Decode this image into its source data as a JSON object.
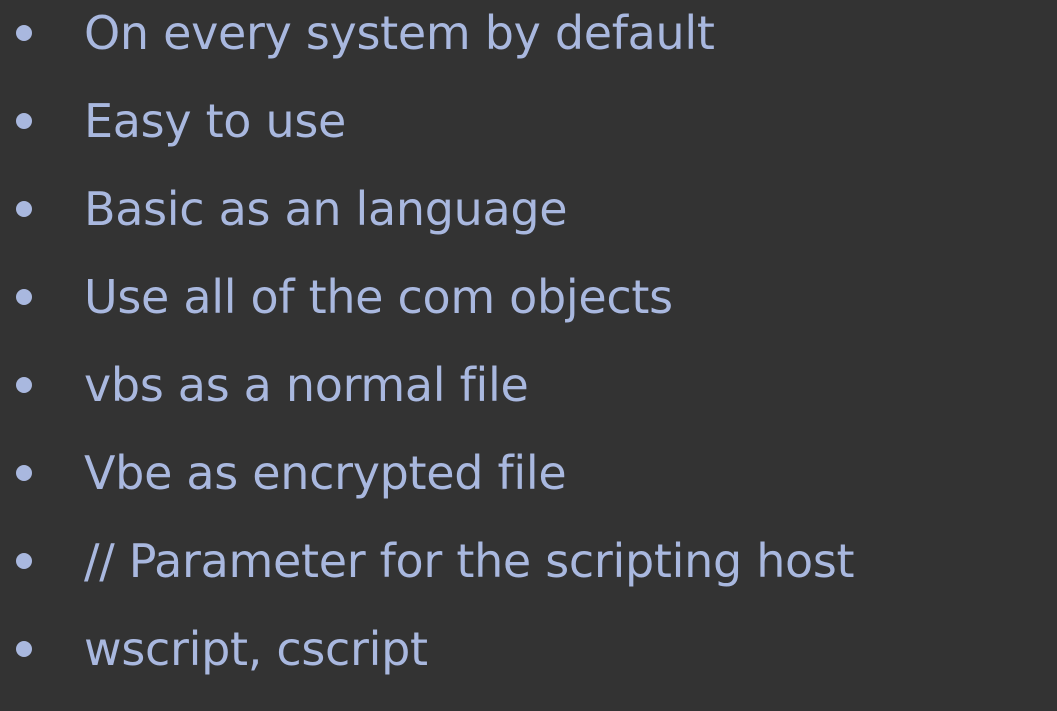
{
  "colors": {
    "background": "#333333",
    "text": "#A9B8DF",
    "bullet": "#A9B8DF"
  },
  "bullets": [
    "On every system by default",
    "Easy to use",
    "Basic as an language",
    "Use all of the com objects",
    "vbs as a normal file",
    "Vbe as encrypted file",
    "// Parameter for the scripting host",
    "wscript, cscript"
  ]
}
